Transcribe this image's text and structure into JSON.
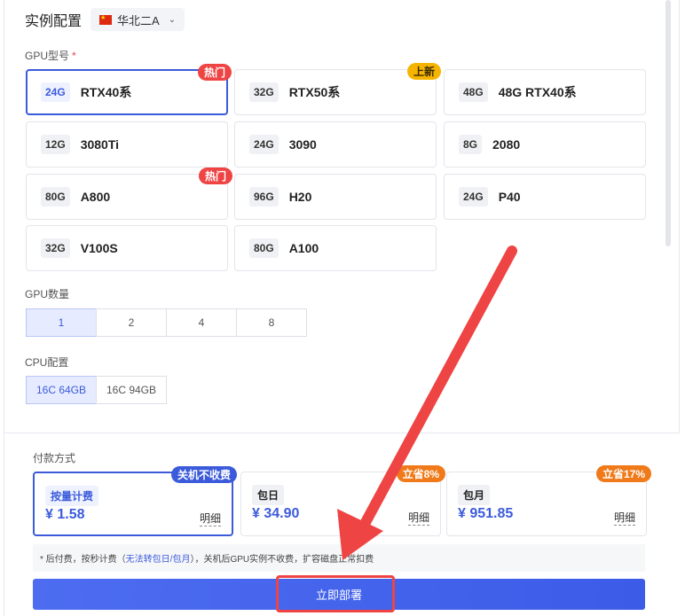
{
  "header": {
    "title": "实例配置",
    "region": "华北二A"
  },
  "gpu_model": {
    "label": "GPU型号",
    "required_mark": "*",
    "options": [
      {
        "mem": "24G",
        "model": "RTX40系",
        "badge": "热门",
        "badge_type": "hot",
        "selected": true
      },
      {
        "mem": "32G",
        "model": "RTX50系",
        "badge": "上新",
        "badge_type": "new",
        "selected": false
      },
      {
        "mem": "48G",
        "model": "48G RTX40系",
        "badge": "",
        "badge_type": "",
        "selected": false
      },
      {
        "mem": "12G",
        "model": "3080Ti",
        "badge": "",
        "badge_type": "",
        "selected": false
      },
      {
        "mem": "24G",
        "model": "3090",
        "badge": "",
        "badge_type": "",
        "selected": false
      },
      {
        "mem": "8G",
        "model": "2080",
        "badge": "",
        "badge_type": "",
        "selected": false
      },
      {
        "mem": "80G",
        "model": "A800",
        "badge": "热门",
        "badge_type": "hot",
        "selected": false
      },
      {
        "mem": "96G",
        "model": "H20",
        "badge": "",
        "badge_type": "",
        "selected": false
      },
      {
        "mem": "24G",
        "model": "P40",
        "badge": "",
        "badge_type": "",
        "selected": false
      },
      {
        "mem": "32G",
        "model": "V100S",
        "badge": "",
        "badge_type": "",
        "selected": false
      },
      {
        "mem": "80G",
        "model": "A100",
        "badge": "",
        "badge_type": "",
        "selected": false
      }
    ]
  },
  "gpu_count": {
    "label": "GPU数量",
    "options": [
      "1",
      "2",
      "4",
      "8"
    ],
    "selected": "1"
  },
  "cpu_config": {
    "label": "CPU配置",
    "options": [
      "16C 64GB",
      "16C 94GB"
    ],
    "selected": "16C 64GB"
  },
  "payment": {
    "label": "付款方式",
    "options": [
      {
        "name": "按量计费",
        "price": "¥ 1.58",
        "detail": "明细",
        "badge": "关机不收费",
        "badge_color": "blue",
        "selected": true
      },
      {
        "name": "包日",
        "price": "¥ 34.90",
        "detail": "明细",
        "badge": "立省8%",
        "badge_color": "orange",
        "selected": false
      },
      {
        "name": "包月",
        "price": "¥ 951.85",
        "detail": "明细",
        "badge": "立省17%",
        "badge_color": "orange",
        "selected": false
      }
    ],
    "note_prefix": "* 后付费，按秒计费（",
    "note_link": "无法转包日/包月",
    "note_suffix": "），关机后GPU实例不收费，扩容磁盘正常扣费"
  },
  "deploy_button": "立即部署",
  "colors": {
    "accent": "#3b5bdb",
    "hot": "#ef4444",
    "new": "#f5b400",
    "orange": "#f07a1a",
    "annotation": "#ef4444"
  }
}
